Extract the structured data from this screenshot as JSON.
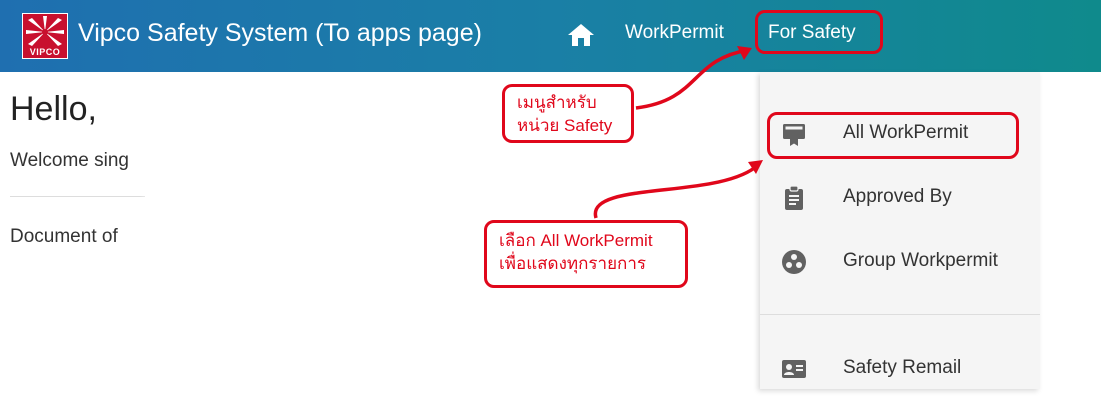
{
  "header": {
    "logo_text": "VIPCO",
    "app_title": "Vipco Safety System (To apps page)",
    "home_icon": "home-icon",
    "nav_workpermit": "WorkPermit",
    "nav_for_safety": "For Safety",
    "bar_colors": [
      "#1f6fb0",
      "#0f8a8c"
    ]
  },
  "main": {
    "greeting": "Hello,",
    "welcome": "Welcome sing",
    "document": "Document of"
  },
  "dropdown": {
    "items": [
      {
        "label": "All WorkPermit",
        "icon": "card-membership-icon"
      },
      {
        "label": "Approved By",
        "icon": "clipboard-icon"
      },
      {
        "label": "Group Workpermit",
        "icon": "group-circle-icon"
      },
      {
        "label": "Safety Remail",
        "icon": "contact-card-icon"
      }
    ]
  },
  "annotations": {
    "menu_callout_line1": "เมนูสำหรับ",
    "menu_callout_line2": "หน่วย Safety",
    "select_callout_line1": "เลือก All WorkPermit",
    "select_callout_line2": "เพื่อแสดงทุกรายการ",
    "highlight_color": "#e0071b"
  }
}
